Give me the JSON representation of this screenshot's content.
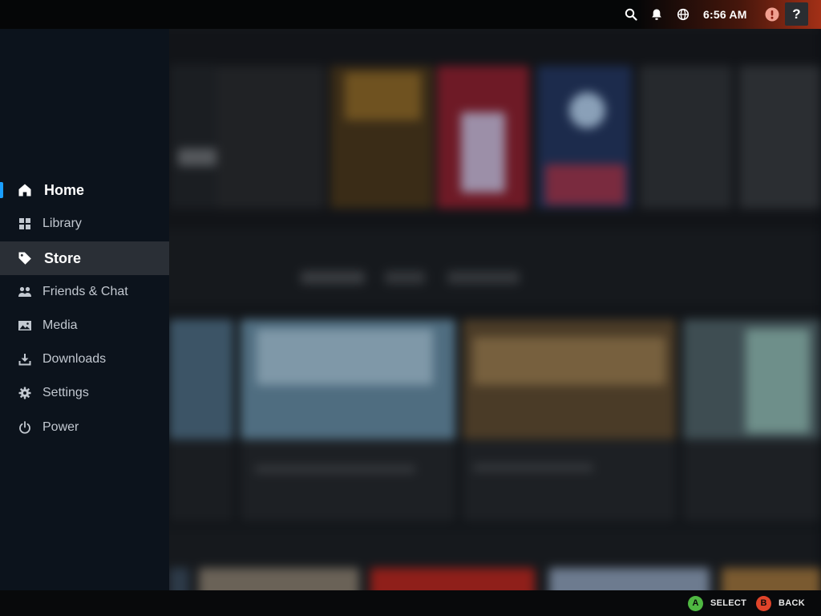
{
  "status_bar": {
    "time": "6:56 AM",
    "icons": [
      "search-icon",
      "notification-bell-icon",
      "globe-icon",
      "alert-icon"
    ],
    "help_label": "?",
    "accent_color": "#be3719"
  },
  "sidebar": {
    "focus_color": "#1a9fff",
    "items": [
      {
        "label": "Home",
        "icon": "home-icon"
      },
      {
        "label": "Library",
        "icon": "grid-icon"
      },
      {
        "label": "Store",
        "icon": "tag-icon"
      },
      {
        "label": "Friends & Chat",
        "icon": "people-icon"
      },
      {
        "label": "Media",
        "icon": "image-icon"
      },
      {
        "label": "Downloads",
        "icon": "download-icon"
      },
      {
        "label": "Settings",
        "icon": "gear-icon"
      },
      {
        "label": "Power",
        "icon": "power-icon"
      }
    ],
    "selected": "Store",
    "focused": "Home"
  },
  "bottom_bar": {
    "select": {
      "button": "A",
      "label": "SELECT",
      "color": "#4fb842"
    },
    "back": {
      "button": "B",
      "label": "BACK",
      "color": "#e0442a"
    }
  }
}
